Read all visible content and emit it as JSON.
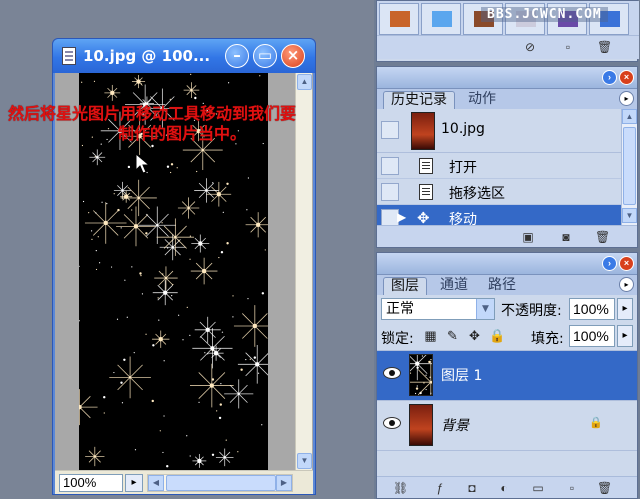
{
  "document_window": {
    "title": "10.jpg @ 100...",
    "zoom": "100%",
    "buttons": {
      "minimize": "–",
      "restore": "▭",
      "close": "×"
    }
  },
  "instruction": {
    "line1": "然后将星光图片用移动工具移动到我们要",
    "line2": "制作的图片当中。"
  },
  "watermark": "BBS.JCWCN.COM",
  "swatches_panel": {
    "swatch_colors": [
      "#c8642a",
      "#5aa6ee",
      "#8a4a2a",
      "#ccccdd",
      "#6a4aa8",
      "#3a72d8"
    ]
  },
  "history_panel": {
    "tabs": [
      "历史记录",
      "动作"
    ],
    "snapshot": "10.jpg",
    "steps": [
      {
        "label": "打开",
        "selected": false
      },
      {
        "label": "拖移选区",
        "selected": false
      },
      {
        "label": "移动",
        "selected": true
      }
    ]
  },
  "layers_panel": {
    "tabs": [
      "图层",
      "通道",
      "路径"
    ],
    "blend_mode": "正常",
    "opacity_label": "不透明度:",
    "opacity": "100%",
    "lock_label": "锁定:",
    "fill_label": "填充:",
    "fill": "100%",
    "layers": [
      {
        "name": "图层 1",
        "selected": true
      },
      {
        "name": "背景",
        "selected": false,
        "locked": true
      }
    ]
  }
}
